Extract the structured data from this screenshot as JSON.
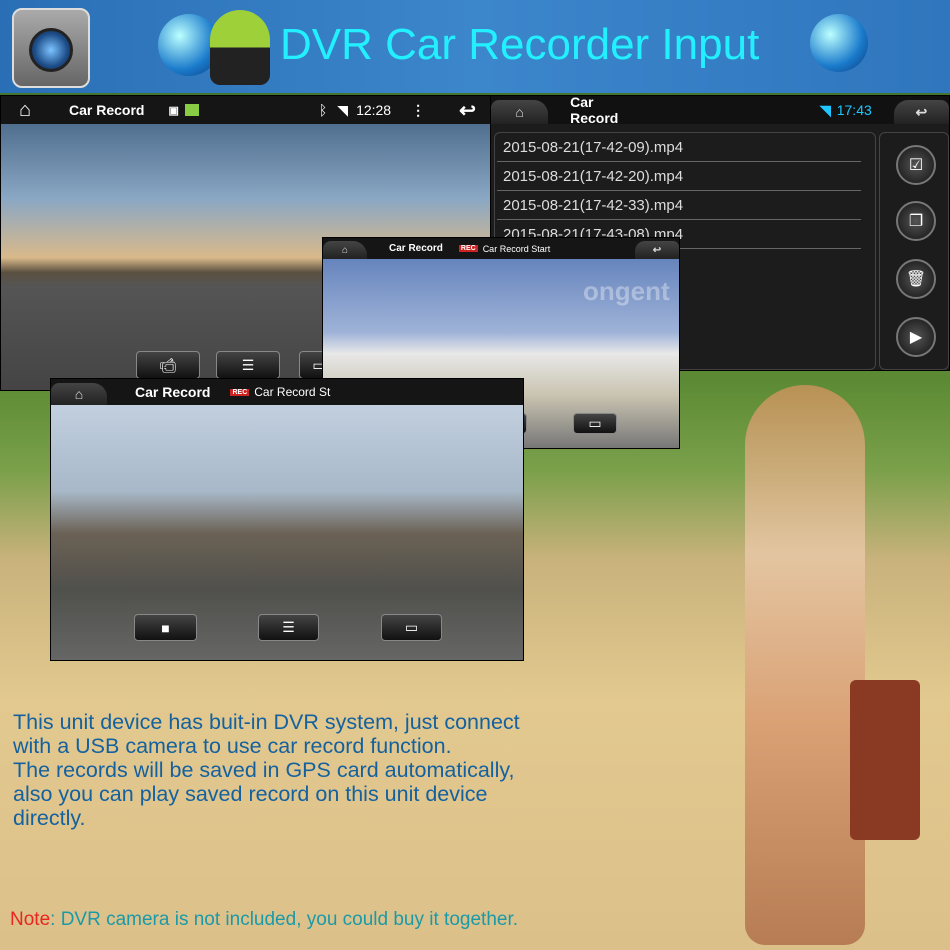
{
  "banner": {
    "title": "DVR Car Recorder Input"
  },
  "screen_main": {
    "title": "Car Record",
    "time": "12:28",
    "icons": [
      "home-icon",
      "image-icon",
      "gallery-icon",
      "bluetooth-icon",
      "wifi-icon",
      "menu-icon",
      "back-icon"
    ],
    "buttons": [
      "camera-icon",
      "list-icon",
      "file-icon"
    ]
  },
  "screen_files": {
    "title": "Car Record",
    "time": "17:43",
    "wifi_color": "#1ec8ff",
    "files": [
      "2015-08-21(17-42-09).mp4",
      "2015-08-21(17-42-20).mp4",
      "2015-08-21(17-42-33).mp4",
      "2015-08-21(17-43-08).mp4"
    ],
    "side_buttons": [
      "select-icon",
      "copy-icon",
      "delete-icon",
      "play-icon"
    ]
  },
  "screen_kremlin": {
    "title": "Car Record",
    "rec": "REC",
    "status": "Car Record Start",
    "watermark": "ongent"
  },
  "screen_city": {
    "title": "Car Record",
    "rec": "REC",
    "status": "Car Record St"
  },
  "description": [
    "This unit device has buit-in DVR system, just connect",
    "with a USB camera to use car record function.",
    "The records will be saved in GPS card automatically,",
    "also you can play saved record on this unit device",
    "directly."
  ],
  "note": {
    "label": "Note",
    "text": ": DVR camera is not included, you could buy it together."
  },
  "colors": {
    "title": "#22f0ff",
    "description": "#15619e",
    "note_label": "#e8261f",
    "note_text": "#1a9aa8"
  }
}
